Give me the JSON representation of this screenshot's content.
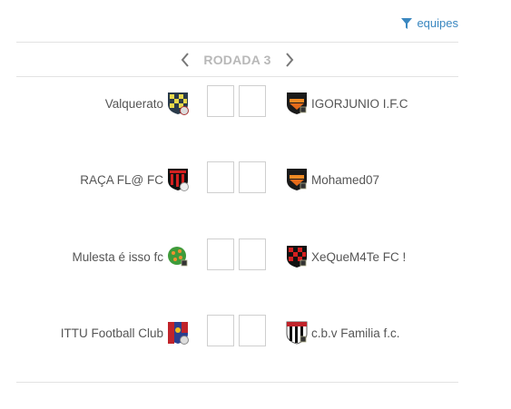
{
  "filter": {
    "label": "equipes",
    "icon": "filter-icon"
  },
  "round": {
    "label": "RODADA 3",
    "prev_icon": "chevron-left-icon",
    "next_icon": "chevron-right-icon"
  },
  "matches": [
    {
      "home": "Valquerato",
      "away": "IGORJUNIO I.F.C",
      "home_score": "",
      "away_score": ""
    },
    {
      "home": "RAÇA FL@ FC",
      "away": "Mohamed07",
      "home_score": "",
      "away_score": ""
    },
    {
      "home": "Mulesta é isso fc",
      "away": "XeQueM4Te FC !",
      "home_score": "",
      "away_score": ""
    },
    {
      "home": "ITTU Football Club",
      "away": "c.b.v Familia f.c.",
      "home_score": "",
      "away_score": ""
    }
  ],
  "colors": {
    "accent": "#3a87c0",
    "muted": "#b8b8b8",
    "border": "#cfcfcf"
  }
}
